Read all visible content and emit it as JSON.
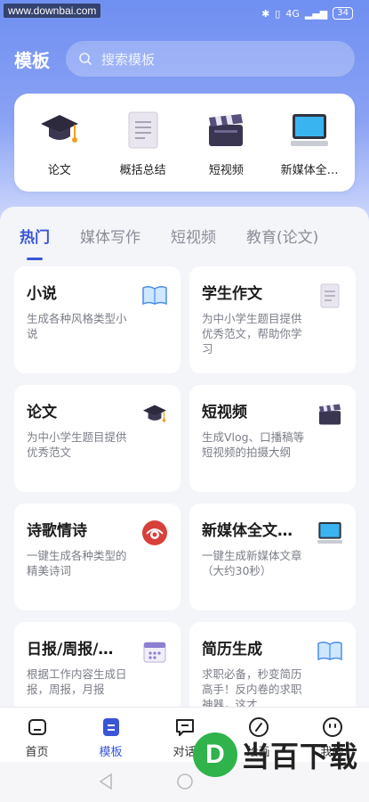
{
  "watermark": "www.downbai.com",
  "status": {
    "battery": "34",
    "network": "4G"
  },
  "header": {
    "title": "模板",
    "search_placeholder": "搜索模板"
  },
  "featured": [
    {
      "label": "论文",
      "icon": "graduation-cap-icon"
    },
    {
      "label": "概括总结",
      "icon": "document-icon"
    },
    {
      "label": "短视频",
      "icon": "clapperboard-icon"
    },
    {
      "label": "新媒体全…",
      "icon": "monitor-icon"
    }
  ],
  "tabs": [
    "热门",
    "媒体写作",
    "短视频",
    "教育(论文)"
  ],
  "cards": [
    {
      "title": "小说",
      "desc": "生成各种风格类型小说",
      "icon": "book-icon"
    },
    {
      "title": "学生作文",
      "desc": "为中小学生题目提供优秀范文，帮助你学习",
      "icon": "document-icon"
    },
    {
      "title": "论文",
      "desc": "为中小学生题目提供优秀范文",
      "icon": "graduation-cap-icon"
    },
    {
      "title": "短视频",
      "desc": "生成Vlog、口播稿等短视频的拍摄大纲",
      "icon": "clapperboard-icon"
    },
    {
      "title": "诗歌情诗",
      "desc": "一键生成各种类型的精美诗词",
      "icon": "poetry-seal-icon"
    },
    {
      "title": "新媒体全文…",
      "desc": "一键生成新媒体文章（大约30秒）",
      "icon": "monitor-icon"
    },
    {
      "title": "日报/周报/…",
      "desc": "根据工作内容生成日报，周报，月报",
      "icon": "calendar-icon"
    },
    {
      "title": "简历生成",
      "desc": "求职必备，秒变简历高手！反内卷的求职神器，这才…",
      "icon": "book-icon"
    }
  ],
  "bottom_nav": [
    {
      "label": "首页",
      "icon": "home-icon",
      "active": false
    },
    {
      "label": "模板",
      "icon": "template-icon",
      "active": true
    },
    {
      "label": "对话",
      "icon": "chat-icon",
      "active": false
    },
    {
      "label": "绘画",
      "icon": "brush-icon",
      "active": false
    },
    {
      "label": "我的",
      "icon": "profile-icon",
      "active": false
    }
  ],
  "bottom_watermark": {
    "letter": "D",
    "text": "当百下载"
  },
  "colors": {
    "accent": "#3a55d6",
    "hero": "#6f8ff1"
  }
}
